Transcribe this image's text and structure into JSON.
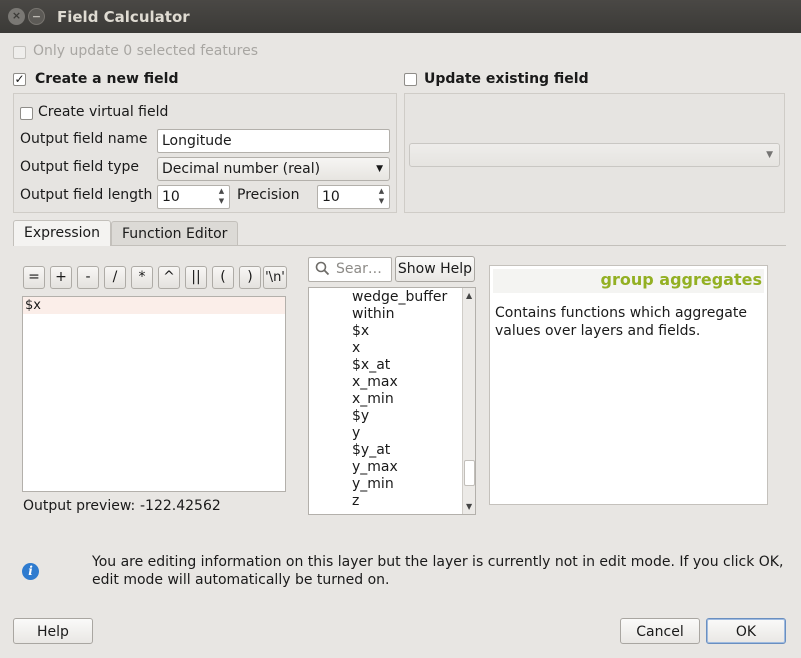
{
  "window": {
    "title": "Field Calculator",
    "close_glyph": "×",
    "minimize_glyph": "−"
  },
  "only_update_label": "Only update 0 selected features",
  "create_new_field": {
    "label": "Create a new field",
    "checked": "✓"
  },
  "update_existing_field": {
    "label": "Update existing field",
    "combo_value": ""
  },
  "create_virtual_field_label": "Create virtual field",
  "output_field_name": {
    "label": "Output field name",
    "value": "Longitude"
  },
  "output_field_type": {
    "label": "Output field type",
    "value": "Decimal number (real)"
  },
  "output_field_length": {
    "label": "Output field length",
    "value": "10"
  },
  "precision": {
    "label": "Precision",
    "value": "10"
  },
  "tabs": [
    {
      "label": "Expression",
      "active": true
    },
    {
      "label": "Function Editor",
      "active": false
    }
  ],
  "operators": [
    "=",
    "+",
    "-",
    "/",
    "*",
    "^",
    "||",
    "(",
    ")",
    "'\\n'"
  ],
  "expression": "$x",
  "output_preview": {
    "label": "Output preview:",
    "value": "-122.42562"
  },
  "search": {
    "placeholder": "Sear…"
  },
  "show_help_label": "Show Help",
  "function_list": [
    "wedge_buffer",
    "within",
    "$x",
    "x",
    "$x_at",
    "x_max",
    "x_min",
    "$y",
    "y",
    "$y_at",
    "y_max",
    "y_min",
    "z"
  ],
  "help_panel": {
    "title": "group aggregates",
    "description": "Contains functions which aggregate values over layers and fields.",
    "title_color": "#93b023"
  },
  "info_message": "You are editing information on this layer but the layer is currently not in edit mode. If you click OK, edit mode will automatically be turned on.",
  "buttons": {
    "help": "Help",
    "cancel": "Cancel",
    "ok": "OK"
  },
  "icons": {
    "info": "info-icon",
    "search": "search-icon",
    "dropdown": "chevron-down-icon"
  }
}
